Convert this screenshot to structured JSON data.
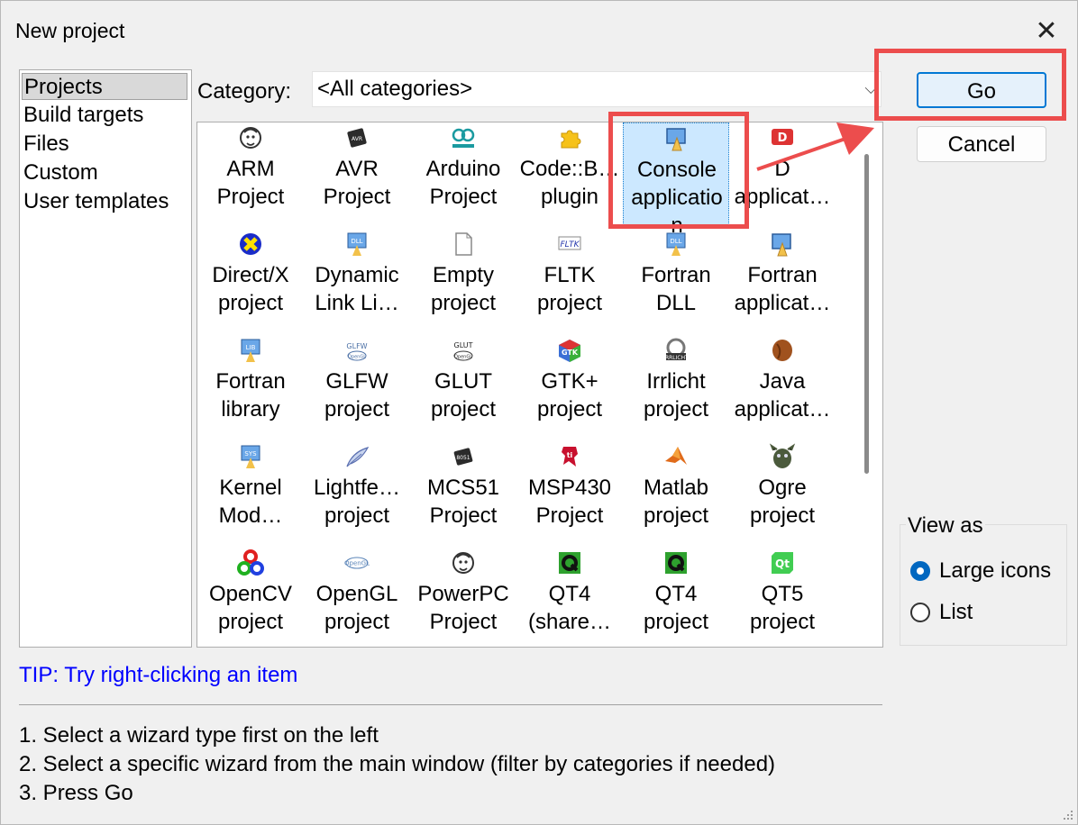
{
  "window": {
    "title": "New project"
  },
  "sidebar": {
    "items": [
      "Projects",
      "Build targets",
      "Files",
      "Custom",
      "User templates"
    ],
    "selected": 0
  },
  "category": {
    "label": "Category:",
    "value": "<All categories>"
  },
  "projects": [
    {
      "line1": "ARM",
      "line2": "Project",
      "icon": "gnu-icon"
    },
    {
      "line1": "AVR",
      "line2": "Project",
      "icon": "avr-chip-icon"
    },
    {
      "line1": "Arduino",
      "line2": "Project",
      "icon": "arduino-icon"
    },
    {
      "line1": "Code::B…",
      "line2": "plugin",
      "icon": "puzzle-icon"
    },
    {
      "line1": "Console",
      "line2": "applicatio",
      "line3": "n",
      "icon": "console-app-icon",
      "selected": true
    },
    {
      "line1": "D",
      "line2": "applicat…",
      "icon": "d-lang-icon"
    },
    {
      "line1": "Direct/X",
      "line2": "project",
      "icon": "directx-icon"
    },
    {
      "line1": "Dynamic",
      "line2": "Link Li…",
      "icon": "dll-icon"
    },
    {
      "line1": "Empty",
      "line2": "project",
      "icon": "blank-file-icon"
    },
    {
      "line1": "FLTK",
      "line2": "project",
      "icon": "fltk-icon"
    },
    {
      "line1": "Fortran",
      "line2": "DLL",
      "icon": "fortran-dll-icon"
    },
    {
      "line1": "Fortran",
      "line2": "applicat…",
      "icon": "fortran-app-icon"
    },
    {
      "line1": "Fortran",
      "line2": "library",
      "icon": "lib-icon"
    },
    {
      "line1": "GLFW",
      "line2": "project",
      "icon": "glfw-icon"
    },
    {
      "line1": "GLUT",
      "line2": "project",
      "icon": "glut-icon"
    },
    {
      "line1": "GTK+",
      "line2": "project",
      "icon": "gtk-icon"
    },
    {
      "line1": "Irrlicht",
      "line2": "project",
      "icon": "irrlicht-icon"
    },
    {
      "line1": "Java",
      "line2": "applicat…",
      "icon": "java-bean-icon"
    },
    {
      "line1": "Kernel",
      "line2": "Mod…",
      "icon": "sys-icon"
    },
    {
      "line1": "Lightfe…",
      "line2": "project",
      "icon": "feather-icon"
    },
    {
      "line1": "MCS51",
      "line2": "Project",
      "icon": "mcs51-chip-icon"
    },
    {
      "line1": "MSP430",
      "line2": "Project",
      "icon": "ti-icon"
    },
    {
      "line1": "Matlab",
      "line2": "project",
      "icon": "matlab-icon"
    },
    {
      "line1": "Ogre",
      "line2": "project",
      "icon": "ogre-icon"
    },
    {
      "line1": "OpenCV",
      "line2": "project",
      "icon": "opencv-icon"
    },
    {
      "line1": "OpenGL",
      "line2": "project",
      "icon": "opengl-icon"
    },
    {
      "line1": "PowerPC",
      "line2": "Project",
      "icon": "gnu-icon"
    },
    {
      "line1": "QT4",
      "line2": "(share…",
      "icon": "qt4-icon"
    },
    {
      "line1": "QT4",
      "line2": "project",
      "icon": "qt4-icon"
    },
    {
      "line1": "QT5",
      "line2": "project",
      "icon": "qt5-icon"
    }
  ],
  "tip": "TIP: Try right-clicking an item",
  "steps": [
    "1. Select a wizard type first on the left",
    "2. Select a specific wizard from the main window (filter by categories if needed)",
    "3. Press Go"
  ],
  "buttons": {
    "go": "Go",
    "cancel": "Cancel"
  },
  "view_as": {
    "title": "View as",
    "options": [
      "Large icons",
      "List"
    ],
    "selected": "Large icons"
  },
  "colors": {
    "accent": "#0078d4",
    "highlight": "#ec4d4d",
    "selection": "#cce8ff",
    "tip": "#0000ff"
  }
}
